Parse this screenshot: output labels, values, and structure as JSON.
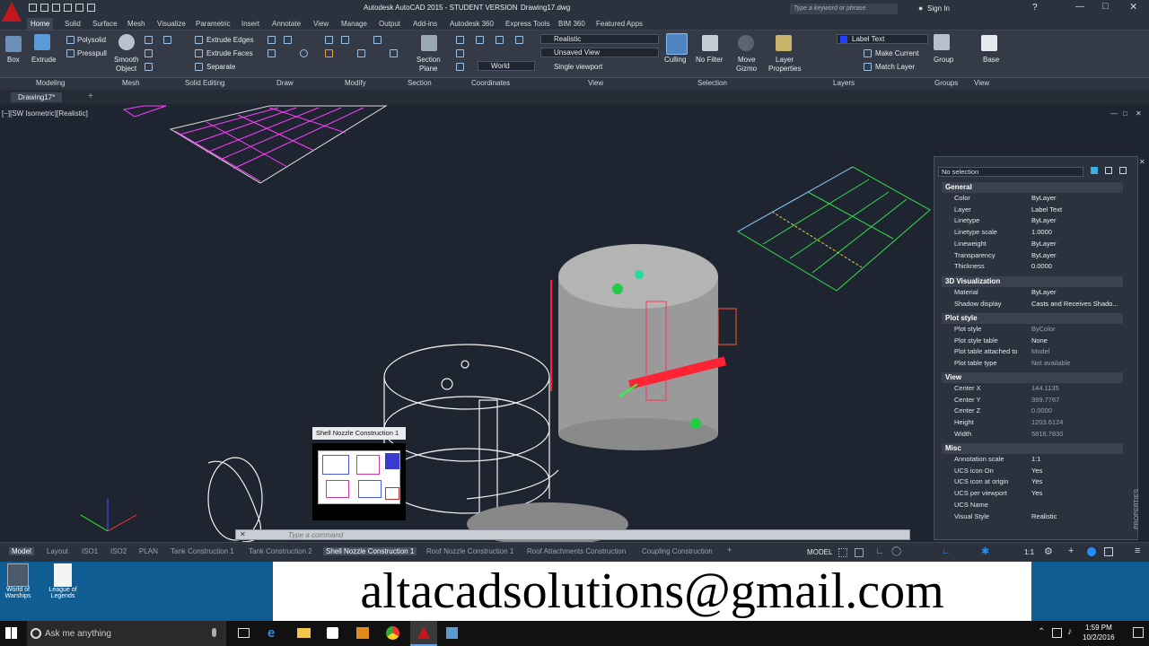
{
  "app": {
    "title": "Autodesk AutoCAD 2015 - STUDENT VERSION",
    "file": "Drawing17.dwg",
    "search_placeholder": "Type a keyword or phrase",
    "sign_in": "Sign In"
  },
  "ribbon_tabs": [
    "Home",
    "Solid",
    "Surface",
    "Mesh",
    "Visualize",
    "Parametric",
    "Insert",
    "Annotate",
    "View",
    "Manage",
    "Output",
    "Add-ins",
    "Autodesk 360",
    "Express Tools",
    "BIM 360",
    "Featured Apps"
  ],
  "ribbon": {
    "box": "Box",
    "extrude": "Extrude",
    "polysolid": "Polysolid",
    "presspull": "Presspull",
    "smooth": "Smooth",
    "object": "Object",
    "extrude_edges": "Extrude Edges",
    "extrude_faces": "Extrude Faces",
    "separate": "Separate",
    "section_plane1": "Section",
    "section_plane2": "Plane",
    "visual_style": "Realistic",
    "view": "Unsaved View",
    "world": "World",
    "single_viewport": "Single viewport",
    "culling": "Culling",
    "no_filter": "No Filter",
    "move_gizmo1": "Move",
    "move_gizmo2": "Gizmo",
    "layer_props1": "Layer",
    "layer_props2": "Properties",
    "layer_name": "Label Text",
    "make_current": "Make Current",
    "match_layer": "Match Layer",
    "group": "Group",
    "base": "Base"
  },
  "panels": [
    "Modeling",
    "Mesh",
    "Solid Editing",
    "Draw",
    "Modify",
    "Section",
    "Coordinates",
    "View",
    "Selection",
    "Layers",
    "Groups",
    "View"
  ],
  "doc_tab": "Drawing17*",
  "viewport_label": "[−][SW Isometric][Realistic]",
  "tooltip": "Shell Nozzle Construction 1",
  "command_placeholder": "Type a command",
  "props": {
    "selection": "No selection",
    "sections": {
      "general": "General",
      "vis3d": "3D Visualization",
      "plot": "Plot style",
      "view": "View",
      "misc": "Misc"
    },
    "general": [
      [
        "Color",
        "ByLayer"
      ],
      [
        "Layer",
        "Label Text"
      ],
      [
        "Linetype",
        "ByLayer"
      ],
      [
        "Linetype scale",
        "1.0000"
      ],
      [
        "Lineweight",
        "ByLayer"
      ],
      [
        "Transparency",
        "ByLayer"
      ],
      [
        "Thickness",
        "0.0000"
      ]
    ],
    "vis3d": [
      [
        "Material",
        "ByLayer"
      ],
      [
        "Shadow display",
        "Casts and Receives Shado..."
      ]
    ],
    "plot": [
      [
        "Plot style",
        "ByColor"
      ],
      [
        "Plot style table",
        "None"
      ],
      [
        "Plot table attached to",
        "Model"
      ],
      [
        "Plot table type",
        "Not available"
      ]
    ],
    "view": [
      [
        "Center X",
        "144.1135"
      ],
      [
        "Center Y",
        "399.7767"
      ],
      [
        "Center Z",
        "0.0000"
      ],
      [
        "Height",
        "1203.6124"
      ],
      [
        "Width",
        "5816.7830"
      ]
    ],
    "misc": [
      [
        "Annotation scale",
        "1:1"
      ],
      [
        "UCS icon On",
        "Yes"
      ],
      [
        "UCS icon at origin",
        "Yes"
      ],
      [
        "UCS per viewport",
        "Yes"
      ],
      [
        "UCS Name",
        ""
      ],
      [
        "Visual Style",
        "Realistic"
      ]
    ],
    "side_label": "PROPERTIES"
  },
  "layout_tabs": [
    "Model",
    "Layout",
    "ISO1",
    "ISO2",
    "PLAN",
    "Tank Construction 1",
    "Tank Construction 2",
    "Shell Nozzle Construction 1",
    "Roof Nozzle Construction 1",
    "Roof Attachments Construction",
    "Coupling Construction"
  ],
  "status": {
    "model": "MODEL",
    "scale": "1:1"
  },
  "desktop": {
    "icon1a": "World of",
    "icon1b": "Warships",
    "icon2a": "League of",
    "icon2b": "Legends"
  },
  "banner": "altacadsolutions@gmail.com",
  "taskbar": {
    "search": "Ask me anything",
    "time": "1:59 PM",
    "date": "10/2/2016"
  },
  "colors": {
    "accent": "#1e90ff",
    "magenta": "#ff00ff",
    "green": "#22dd44",
    "red": "#ff2233"
  }
}
